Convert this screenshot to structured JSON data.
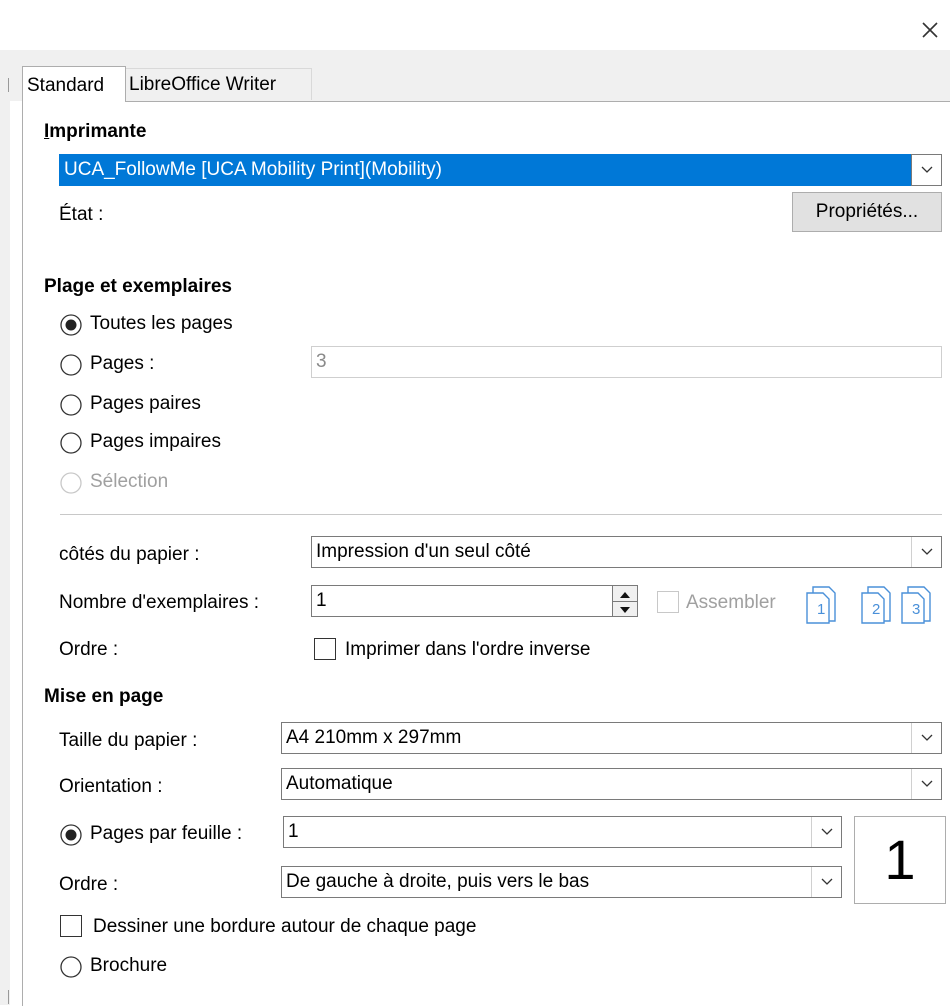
{
  "window": {
    "close_label": "×"
  },
  "tabs": [
    {
      "label": "Standard",
      "active": true
    },
    {
      "label": "LibreOffice Writer",
      "active": false
    }
  ],
  "printer": {
    "section_title": "Imprimante",
    "selected": "UCA_FollowMe [UCA Mobility Print](Mobility)",
    "state_label": "État :",
    "properties_button": "Propriétés..."
  },
  "range": {
    "section_title": "Plage et exemplaires",
    "options": [
      {
        "label": "Toutes les pages",
        "checked": true,
        "enabled": true
      },
      {
        "label": "Pages :",
        "checked": false,
        "enabled": true
      },
      {
        "label": "Pages paires",
        "checked": false,
        "enabled": true
      },
      {
        "label": "Pages impaires",
        "checked": false,
        "enabled": true
      },
      {
        "label": "Sélection",
        "checked": false,
        "enabled": false
      }
    ],
    "pages_value": "3",
    "sides_label": "côtés du papier :",
    "sides_value": "Impression d'un seul côté",
    "copies_label": "Nombre d'exemplaires :",
    "copies_value": "1",
    "collate_label": "Assembler",
    "collate_checked": false,
    "collate_enabled": false,
    "collate_pages": [
      "1",
      "2",
      "3"
    ],
    "order_label": "Ordre :",
    "reverse_label": "Imprimer dans l'ordre inverse",
    "reverse_checked": false
  },
  "layout": {
    "section_title": "Mise en page",
    "paper_size_label": "Taille du papier :",
    "paper_size_value": "A4 210mm x 297mm",
    "orientation_label": "Orientation :",
    "orientation_value": "Automatique",
    "pages_per_sheet_label": "Pages par feuille :",
    "pages_per_sheet_value": "1",
    "pages_per_sheet_checked": true,
    "order_label": "Ordre :",
    "order_value": "De gauche à droite, puis vers le bas",
    "preview_value": "1",
    "border_label": "Dessiner une bordure autour de chaque page",
    "border_checked": false,
    "brochure_label": "Brochure",
    "brochure_checked": false
  },
  "colors": {
    "accent": "#0078d7",
    "disabled": "#a0a0a0",
    "collate_icon": "#4a90d9"
  }
}
